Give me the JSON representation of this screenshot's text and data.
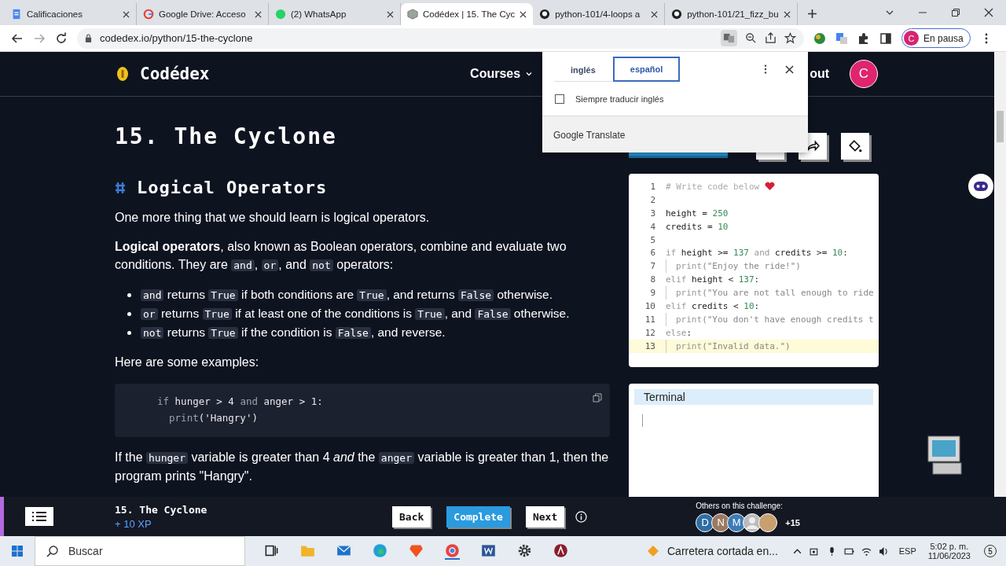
{
  "browser": {
    "tabs": [
      {
        "title": "Calificaciones",
        "kind": "doc",
        "selected": false
      },
      {
        "title": "Google Drive: Acceso",
        "kind": "google",
        "selected": false
      },
      {
        "title": "(2) WhatsApp",
        "kind": "chat",
        "selected": false
      },
      {
        "title": "Codédex | 15. The Cyc",
        "kind": "cube",
        "selected": true
      },
      {
        "title": "python-101/4-loops a",
        "kind": "github",
        "selected": false
      },
      {
        "title": "python-101/21_fizz_bu",
        "kind": "github",
        "selected": false
      }
    ],
    "url": "codedex.io/python/15-the-cyclone",
    "profile": {
      "initial": "C",
      "label": "En pausa"
    }
  },
  "site": {
    "logo": "Codédex",
    "nav": [
      {
        "label": "Courses",
        "dropdown": true
      },
      {
        "label": "out",
        "dropdown": false
      }
    ],
    "avatar": "C"
  },
  "translate_popup": {
    "tabs": [
      {
        "label": "inglés",
        "selected": false
      },
      {
        "label": "español",
        "selected": true
      }
    ],
    "always": {
      "label": "Siempre traducir inglés",
      "checked": false
    },
    "footer": "Google Translate"
  },
  "lesson": {
    "title": "15. The Cyclone",
    "section": "Logical Operators",
    "blocks": [
      {
        "kind": "p",
        "parts": [
          {
            "kind": "text",
            "s": "One more thing that we should learn is logical operators."
          }
        ]
      },
      {
        "kind": "p",
        "parts": [
          {
            "kind": "bold",
            "s": "Logical operators"
          },
          {
            "kind": "text",
            "s": ", also known as Boolean operators, combine and evaluate two conditions. They are "
          },
          {
            "kind": "code",
            "s": "and"
          },
          {
            "kind": "text",
            "s": ", "
          },
          {
            "kind": "code",
            "s": "or"
          },
          {
            "kind": "text",
            "s": ", and "
          },
          {
            "kind": "code",
            "s": "not"
          },
          {
            "kind": "text",
            "s": " operators:"
          }
        ]
      },
      {
        "kind": "ul",
        "items": [
          [
            {
              "kind": "code",
              "s": "and"
            },
            {
              "kind": "text",
              "s": " returns "
            },
            {
              "kind": "code",
              "s": "True"
            },
            {
              "kind": "text",
              "s": " if both conditions are "
            },
            {
              "kind": "code",
              "s": "True"
            },
            {
              "kind": "text",
              "s": ", and returns "
            },
            {
              "kind": "code",
              "s": "False"
            },
            {
              "kind": "text",
              "s": " otherwise."
            }
          ],
          [
            {
              "kind": "code",
              "s": "or"
            },
            {
              "kind": "text",
              "s": " returns "
            },
            {
              "kind": "code",
              "s": "True"
            },
            {
              "kind": "text",
              "s": " if at least one of the conditions is "
            },
            {
              "kind": "code",
              "s": "True"
            },
            {
              "kind": "text",
              "s": ", and "
            },
            {
              "kind": "code",
              "s": "False"
            },
            {
              "kind": "text",
              "s": " otherwise."
            }
          ],
          [
            {
              "kind": "code",
              "s": "not"
            },
            {
              "kind": "text",
              "s": " returns "
            },
            {
              "kind": "code",
              "s": "True"
            },
            {
              "kind": "text",
              "s": " if the condition is "
            },
            {
              "kind": "code",
              "s": "False"
            },
            {
              "kind": "text",
              "s": ", and reverse."
            }
          ]
        ]
      },
      {
        "kind": "p",
        "parts": [
          {
            "kind": "text",
            "s": "Here are some examples:"
          }
        ]
      },
      {
        "kind": "code",
        "lines": [
          {
            "tokens": [
              {
                "kind": "kw",
                "s": "if"
              },
              {
                "kind": "text",
                "s": " hunger > 4 "
              },
              {
                "kind": "kw",
                "s": "and"
              },
              {
                "kind": "text",
                "s": " anger > 1:"
              }
            ]
          },
          {
            "tokens": [
              {
                "kind": "kw",
                "s": "  print"
              },
              {
                "kind": "text",
                "s": "('Hangry')"
              }
            ]
          }
        ]
      },
      {
        "kind": "p",
        "parts": [
          {
            "kind": "text",
            "s": "If the "
          },
          {
            "kind": "code",
            "s": "hunger"
          },
          {
            "kind": "text",
            "s": " variable is greater than 4 "
          },
          {
            "kind": "italic",
            "s": "and"
          },
          {
            "kind": "text",
            "s": " the "
          },
          {
            "kind": "code",
            "s": "anger"
          },
          {
            "kind": "text",
            "s": " variable is greater than 1, then the program prints \"Hangry\"."
          }
        ]
      }
    ]
  },
  "editor": {
    "lines": [
      {
        "n": "1",
        "indent": false,
        "tokens": [
          {
            "kind": "cm",
            "s": "# Write code below "
          },
          {
            "kind": "heart"
          }
        ]
      },
      {
        "n": "2",
        "indent": false
      },
      {
        "n": "3",
        "indent": false,
        "tokens": [
          {
            "kind": "text",
            "s": "height = "
          },
          {
            "kind": "num",
            "s": "250"
          }
        ]
      },
      {
        "n": "4",
        "indent": false,
        "tokens": [
          {
            "kind": "text",
            "s": "credits = "
          },
          {
            "kind": "num",
            "s": "10"
          }
        ]
      },
      {
        "n": "5",
        "indent": false
      },
      {
        "n": "6",
        "indent": false,
        "tokens": [
          {
            "kind": "kw",
            "s": "if"
          },
          {
            "kind": "text",
            "s": " height >= "
          },
          {
            "kind": "num",
            "s": "137"
          },
          {
            "kind": "kw",
            "s": " and"
          },
          {
            "kind": "text",
            "s": " credits >= "
          },
          {
            "kind": "num",
            "s": "10"
          },
          {
            "kind": "text",
            "s": ":"
          }
        ]
      },
      {
        "n": "7",
        "indent": true,
        "tokens": [
          {
            "kind": "kw",
            "s": "print"
          },
          {
            "kind": "str",
            "s": "(\"Enjoy the ride!\")"
          }
        ]
      },
      {
        "n": "8",
        "indent": false,
        "tokens": [
          {
            "kind": "kw",
            "s": "elif"
          },
          {
            "kind": "text",
            "s": " height < "
          },
          {
            "kind": "num",
            "s": "137"
          },
          {
            "kind": "text",
            "s": ":"
          }
        ]
      },
      {
        "n": "9",
        "indent": true,
        "tokens": [
          {
            "kind": "kw",
            "s": "print"
          },
          {
            "kind": "str",
            "s": "(\"You are not tall enough to ride"
          }
        ]
      },
      {
        "n": "10",
        "indent": false,
        "tokens": [
          {
            "kind": "kw",
            "s": "elif"
          },
          {
            "kind": "text",
            "s": " credits < "
          },
          {
            "kind": "num",
            "s": "10"
          },
          {
            "kind": "text",
            "s": ":"
          }
        ]
      },
      {
        "n": "11",
        "indent": true,
        "tokens": [
          {
            "kind": "kw",
            "s": "print"
          },
          {
            "kind": "str",
            "s": "(\"You don't have enough credits t"
          }
        ]
      },
      {
        "n": "12",
        "indent": false,
        "tokens": [
          {
            "kind": "kw",
            "s": "else"
          },
          {
            "kind": "text",
            "s": ":"
          }
        ]
      },
      {
        "n": "13",
        "indent": true,
        "active": true,
        "tokens": [
          {
            "kind": "kw",
            "s": "print"
          },
          {
            "kind": "str",
            "s": "(\"Invalid data.\")"
          }
        ]
      }
    ]
  },
  "terminal": {
    "title": "Terminal"
  },
  "bottom_bar": {
    "title": "15. The Cyclone",
    "xp": "+ 10 XP",
    "buttons": [
      {
        "label": "Back",
        "kind": "plain"
      },
      {
        "label": "Complete",
        "kind": "primary"
      },
      {
        "label": "Next",
        "kind": "plain"
      }
    ],
    "others_label": "Others on this challenge:",
    "avatars": [
      {
        "initial": "D",
        "color": "#2f6ea5"
      },
      {
        "initial": "N",
        "color": "#9c7a62"
      },
      {
        "initial": "M",
        "color": "#3b7cb8"
      }
    ],
    "more": "+15"
  },
  "taskbar": {
    "search": "Buscar",
    "news": "Carretera cortada en...",
    "lang": "ESP",
    "time": "5:02 p. m.",
    "date": "11/06/2023",
    "notifications": "5"
  }
}
